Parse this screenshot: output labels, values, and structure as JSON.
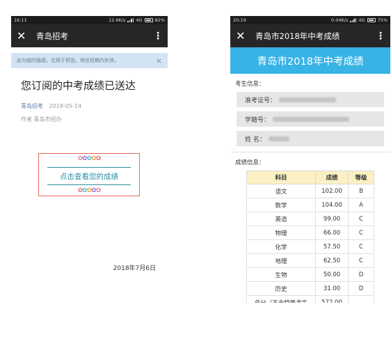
{
  "left": {
    "status": {
      "time": "16:11",
      "speed": "12.6K/s",
      "network": "4G",
      "battery": "82%"
    },
    "nav": {
      "close": "✕",
      "title": "青岛招考",
      "more": "⋮"
    },
    "notice": {
      "text": "此为临时链接，仅用于预览，将在短期内失效。",
      "close": "×"
    },
    "article": {
      "title": "您订阅的中考成绩已送达",
      "account": "青岛招考",
      "date": "2018-05-14",
      "author": "作者 青岛市招办",
      "cta": "点击查看您的成绩",
      "footer_date": "2018年7月6日"
    }
  },
  "right": {
    "status": {
      "time": "20:19",
      "speed": "0.04K/s",
      "network": "4G",
      "battery": "75%"
    },
    "nav": {
      "close": "✕",
      "title": "青岛市2018年中考成绩",
      "more": "⋮"
    },
    "banner": "青岛市2018年中考成绩",
    "student_section": "考生信息：",
    "fields": {
      "exam_no_label": "准考证号：",
      "student_no_label": "学籍号：",
      "name_label": "姓 名："
    },
    "score_section": "成绩信息：",
    "table": {
      "headers": [
        "科目",
        "成绩",
        "等级"
      ],
      "rows": [
        [
          "语文",
          "102.00",
          "B"
        ],
        [
          "数学",
          "104.00",
          "A"
        ],
        [
          "英语",
          "99.00",
          "C"
        ],
        [
          "物理",
          "66.00",
          "C"
        ],
        [
          "化学",
          "57.50",
          "C"
        ],
        [
          "地理",
          "62.50",
          "C"
        ],
        [
          "生物",
          "50.00",
          "D"
        ],
        [
          "历史",
          "31.00",
          "D"
        ],
        [
          "总分（不含特殊考生",
          "572.00",
          ""
        ]
      ]
    }
  }
}
